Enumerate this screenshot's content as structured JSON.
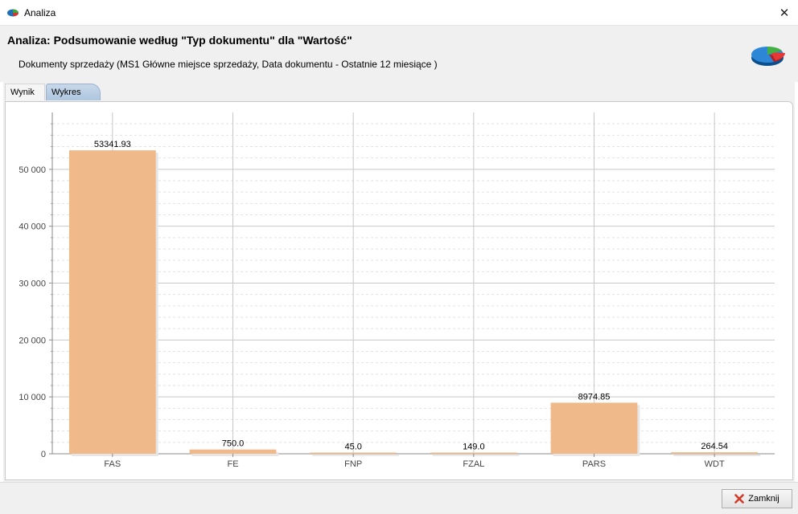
{
  "window": {
    "title": "Analiza",
    "close_glyph": "✕"
  },
  "header": {
    "title": "Analiza: Podsumowanie według \"Typ dokumentu\" dla \"Wartość\"",
    "subtitle": "Dokumenty sprzedaży (MS1 Główne miejsce sprzedaży, Data dokumentu - Ostatnie 12 miesiące )"
  },
  "tabs": [
    {
      "label": "Wynik",
      "active": false
    },
    {
      "label": "Wykres",
      "active": true
    }
  ],
  "chart_data": {
    "type": "bar",
    "categories": [
      "FAS",
      "FE",
      "FNP",
      "FZAL",
      "PARS",
      "WDT"
    ],
    "values": [
      53341.93,
      750.0,
      45.0,
      149.0,
      8974.85,
      264.54
    ],
    "value_labels": [
      "53341.93",
      "750.0",
      "45.0",
      "149.0",
      "8974.85",
      "264.54"
    ],
    "ylim": [
      0,
      60000
    ],
    "yticks": [
      0,
      10000,
      20000,
      30000,
      40000,
      50000
    ],
    "ytick_labels": [
      "0",
      "10 000",
      "20 000",
      "30 000",
      "40 000",
      "50 000"
    ],
    "title": "",
    "xlabel": "",
    "ylabel": "",
    "grid": true,
    "bar_color": "#f0b98a"
  },
  "footer": {
    "close_label": "Zamknij"
  }
}
